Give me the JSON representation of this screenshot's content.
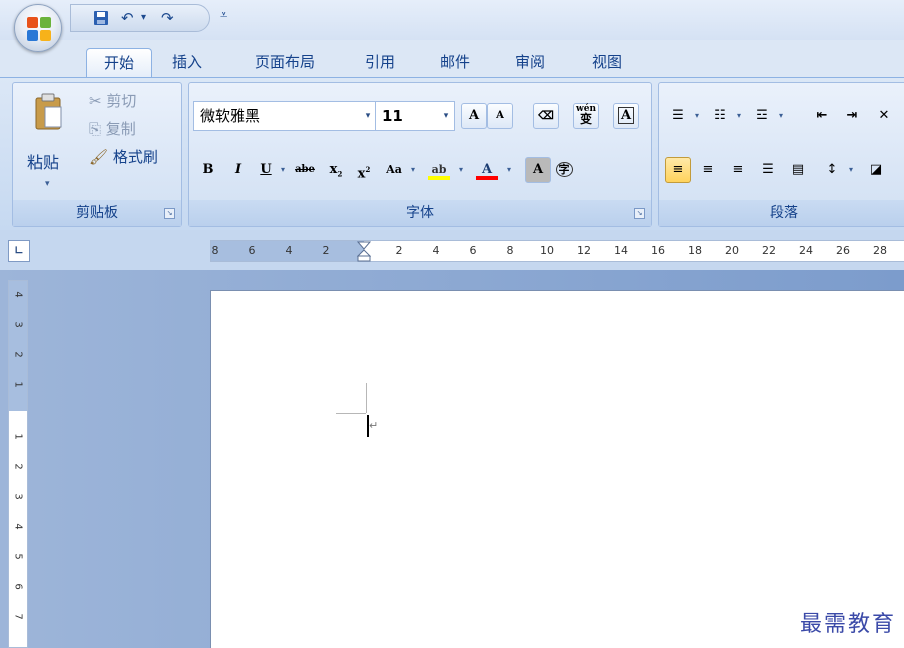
{
  "quick_access": {
    "save_icon": "save-icon",
    "undo_icon": "undo-icon",
    "redo_icon": "redo-icon",
    "customize_icon": "customize-qat-icon"
  },
  "tabs": [
    {
      "label": "开始",
      "active": true
    },
    {
      "label": "插入",
      "active": false
    },
    {
      "label": "页面布局",
      "active": false
    },
    {
      "label": "引用",
      "active": false
    },
    {
      "label": "邮件",
      "active": false
    },
    {
      "label": "审阅",
      "active": false
    },
    {
      "label": "视图",
      "active": false
    }
  ],
  "clipboard": {
    "paste_label": "粘贴",
    "cut_label": "剪切",
    "copy_label": "复制",
    "format_painter_label": "格式刷",
    "group_label": "剪贴板"
  },
  "font": {
    "font_name": "微软雅黑",
    "font_size": "11",
    "group_label": "字体",
    "grow_label": "A",
    "shrink_label": "A",
    "bold": "B",
    "italic": "I",
    "underline": "U",
    "strikethrough": "abe",
    "subscript": "x",
    "superscript": "x",
    "change_case": "Aa",
    "font_color": "A",
    "char_shading": "A",
    "enclose": "字",
    "phonetic": "wén",
    "phonetic_char": "变",
    "border_char": "A",
    "highlight_color": "#ffff00",
    "font_color_value": "#ff0000"
  },
  "paragraph": {
    "group_label": "段落"
  },
  "ruler": {
    "h_labels": [
      "8",
      "6",
      "4",
      "2",
      "2",
      "4",
      "6",
      "8",
      "10",
      "12",
      "14",
      "16",
      "18",
      "20",
      "22",
      "24",
      "26",
      "28"
    ],
    "v_labels": [
      "4",
      "3",
      "2",
      "1",
      "1",
      "2",
      "3",
      "4",
      "5",
      "6",
      "7"
    ]
  },
  "watermark": "最需教育"
}
